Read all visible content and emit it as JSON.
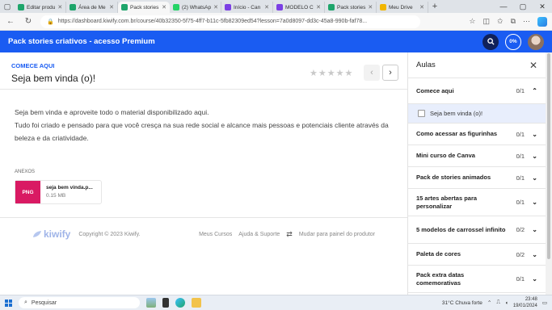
{
  "browser": {
    "tabs": [
      {
        "label": "Editar produ",
        "color": "#1ea56b"
      },
      {
        "label": "Área de Me",
        "color": "#1ea56b"
      },
      {
        "label": "Pack stories",
        "color": "#1ea56b",
        "active": true
      },
      {
        "label": "(2) WhatsAp",
        "color": "#25d366"
      },
      {
        "label": "Início - Can",
        "color": "#7b3fe4"
      },
      {
        "label": "MODELO C",
        "color": "#7b3fe4"
      },
      {
        "label": "Pack stories",
        "color": "#1ea56b"
      },
      {
        "label": "Meu Drive",
        "color": "#f2b600"
      }
    ],
    "url": "https://dashboard.kiwify.com.br/course/40b32350-5f75-4ff7-b11c-5fb82309ed54?lesson=7a0d8097-dd3c-45a8-990b-faf78..."
  },
  "header": {
    "title": "Pack stories criativos - acesso Premium",
    "progress": "0%"
  },
  "lesson": {
    "section": "COMECE AQUI",
    "title": "Seja bem vinda (o)!",
    "rating_stars": 5,
    "paragraph1": "Seja bem vinda e aproveite todo o material disponibilizado aqui.",
    "paragraph2": "Tudo foi criado e pensado para que você cresça na sua rede social e alcance mais pessoas e potenciais cliente através da beleza e da criatividade.",
    "attachments_label": "ANEXOS",
    "attachment": {
      "type": "PNG",
      "name": "seja bem vinda.p...",
      "size": "0.15 MB"
    }
  },
  "footer": {
    "logo": "kiwify",
    "copyright": "Copyright © 2023 Kiwify.",
    "link1": "Meus Cursos",
    "link2": "Ajuda & Suporte",
    "switch": "Mudar para painel do produtor"
  },
  "sidebar": {
    "title": "Aulas",
    "modules": [
      {
        "title": "Comece aqui",
        "count": "0/1",
        "open": true
      },
      {
        "title": "Como acessar as figurinhas",
        "count": "0/1"
      },
      {
        "title": "Mini curso de Canva",
        "count": "0/1"
      },
      {
        "title": "Pack de stories animados",
        "count": "0/1"
      },
      {
        "title": "15 artes abertas para personalizar",
        "count": "0/1"
      },
      {
        "title": "5 modelos de carrossel infinito",
        "count": "0/2"
      },
      {
        "title": "Paleta de cores",
        "count": "0/2"
      },
      {
        "title": "Pack extra datas comemorativas",
        "count": "0/1"
      }
    ],
    "open_lesson": "Seja bem vinda (o)!"
  },
  "taskbar": {
    "search": "Pesquisar",
    "weather": "31°C  Chuva forte",
    "time": "23:48",
    "date": "19/01/2024"
  }
}
